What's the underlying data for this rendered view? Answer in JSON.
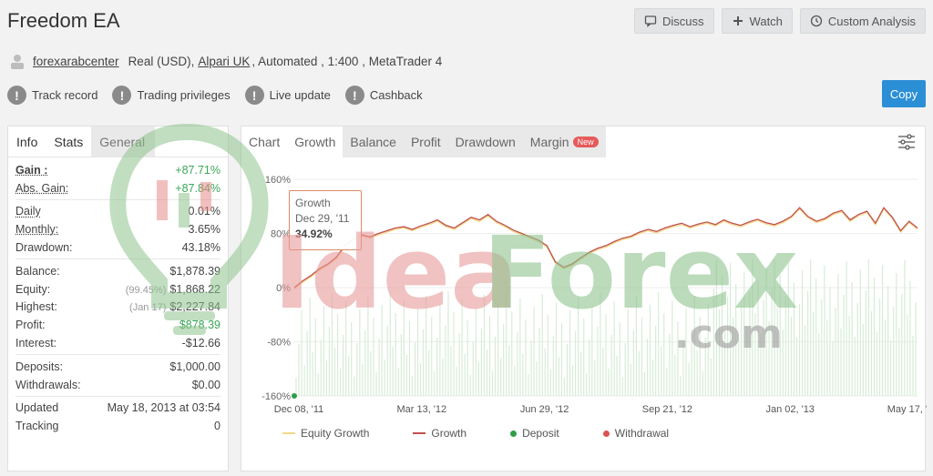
{
  "header": {
    "title": "Freedom EA",
    "actions": [
      {
        "label": "Discuss",
        "icon": "chat-icon"
      },
      {
        "label": "Watch",
        "icon": "plus-icon"
      },
      {
        "label": "Custom Analysis",
        "icon": "clock-icon"
      }
    ]
  },
  "meta": {
    "user": "forexarabcenter",
    "account": "Real (USD),",
    "broker": "Alpari UK",
    "details": ", Automated , 1:400 , MetaTrader 4"
  },
  "badges": [
    "Track record",
    "Trading privileges",
    "Live update",
    "Cashback"
  ],
  "copy_label": "Copy",
  "left_tabs": [
    "Info",
    "Stats",
    "General"
  ],
  "stats": {
    "gain": {
      "label": "Gain :",
      "value": "+87.71%"
    },
    "abs_gain": {
      "label": "Abs. Gain:",
      "value": "+87.84%"
    },
    "daily": {
      "label": "Daily",
      "value": "0.01%"
    },
    "monthly": {
      "label": "Monthly:",
      "value": "3.65%"
    },
    "drawdown": {
      "label": "Drawdown:",
      "value": "43.18%"
    },
    "balance": {
      "label": "Balance:",
      "value": "$1,878.39"
    },
    "equity": {
      "label": "Equity:",
      "pct": "(99.45%)",
      "value": "$1,868.22"
    },
    "highest": {
      "label": "Highest:",
      "date": "(Jan 17)",
      "value": "$2,227.84"
    },
    "profit": {
      "label": "Profit:",
      "value": "$878.39"
    },
    "interest": {
      "label": "Interest:",
      "value": "-$12.66"
    },
    "deposits": {
      "label": "Deposits:",
      "value": "$1,000.00"
    },
    "withdrawals": {
      "label": "Withdrawals:",
      "value": "$0.00"
    },
    "updated": {
      "label": "Updated",
      "value": "May 18, 2013 at 03:54"
    },
    "tracking": {
      "label": "Tracking",
      "value": "0"
    }
  },
  "chart_tabs": [
    {
      "label": "Chart",
      "style": "white"
    },
    {
      "label": "Growth",
      "style": "white"
    },
    {
      "label": "Balance",
      "style": "grey"
    },
    {
      "label": "Profit",
      "style": "grey"
    },
    {
      "label": "Drawdown",
      "style": "grey"
    },
    {
      "label": "Margin",
      "style": "grey"
    }
  ],
  "new_badge": "New",
  "tooltip": {
    "title": "Growth",
    "date": "Dec 29, '11",
    "value": "34.92%"
  },
  "legend": [
    {
      "label": "Equity Growth",
      "color": "#f2d98a",
      "kind": "line"
    },
    {
      "label": "Growth",
      "color": "#c0504d",
      "kind": "line"
    },
    {
      "label": "Deposit",
      "color": "#2e9e47",
      "kind": "dot"
    },
    {
      "label": "Withdrawal",
      "color": "#d9534f",
      "kind": "dot"
    }
  ],
  "watermark": {
    "text_left": "Idea",
    "text_right": "Forex",
    "domain": ".com"
  },
  "chart_data": {
    "type": "line",
    "ylim": [
      -160,
      160
    ],
    "yticks": [
      "160%",
      "80%",
      "0%",
      "-80%",
      "-160%"
    ],
    "xticks": [
      "Dec 08, '11",
      "Mar 13, '12",
      "Jun 29, '12",
      "Sep 21, '12",
      "Jan 02, '13",
      "May 17, '13"
    ],
    "series": [
      {
        "name": "Growth",
        "values": [
          0,
          10,
          18,
          28,
          35,
          45,
          62,
          72,
          78,
          75,
          80,
          84,
          88,
          90,
          86,
          91,
          95,
          100,
          92,
          88,
          96,
          104,
          100,
          108,
          98,
          92,
          85,
          80,
          75,
          70,
          62,
          38,
          30,
          35,
          44,
          52,
          58,
          62,
          68,
          73,
          76,
          82,
          86,
          83,
          88,
          92,
          95,
          90,
          94,
          97,
          93,
          100,
          95,
          92,
          97,
          101,
          96,
          93,
          98,
          105,
          118,
          105,
          98,
          102,
          110,
          114,
          100,
          108,
          113,
          95,
          118,
          104,
          84,
          98,
          88
        ]
      }
    ],
    "deposits": [
      {
        "x_index": 0,
        "value": -160
      }
    ],
    "bars_note": "faint green daily bars beneath the line"
  }
}
